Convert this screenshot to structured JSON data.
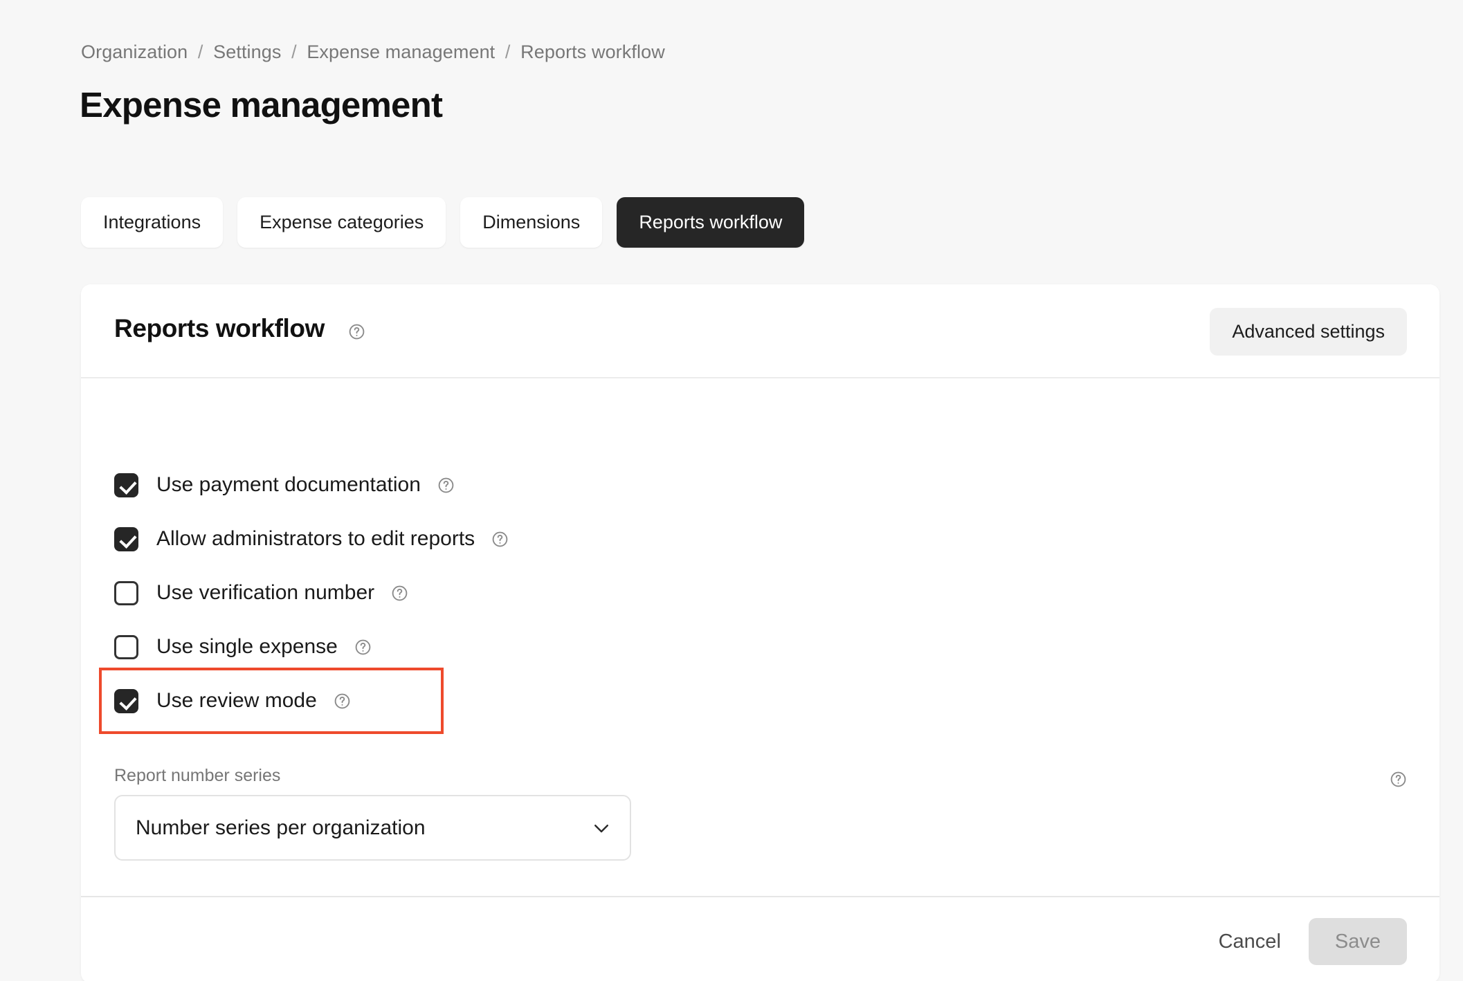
{
  "breadcrumb": {
    "items": [
      "Organization",
      "Settings",
      "Expense management",
      "Reports workflow"
    ],
    "separator": "/"
  },
  "page": {
    "title": "Expense management"
  },
  "tabs": [
    {
      "label": "Integrations",
      "active": false
    },
    {
      "label": "Expense categories",
      "active": false
    },
    {
      "label": "Dimensions",
      "active": false
    },
    {
      "label": "Reports workflow",
      "active": true
    }
  ],
  "card": {
    "title": "Reports workflow",
    "title_help_icon": "help-circle-icon",
    "advanced_settings_label": "Advanced settings"
  },
  "checkboxes": [
    {
      "label": "Use payment documentation",
      "checked": true,
      "help_icon": "help-circle-icon",
      "highlighted": false
    },
    {
      "label": "Allow administrators to edit reports",
      "checked": true,
      "help_icon": "help-circle-icon",
      "highlighted": false
    },
    {
      "label": "Use verification number",
      "checked": false,
      "help_icon": "help-circle-icon",
      "highlighted": false
    },
    {
      "label": "Use single expense",
      "checked": false,
      "help_icon": "help-circle-icon",
      "highlighted": false
    },
    {
      "label": "Use review mode",
      "checked": true,
      "help_icon": "help-circle-icon",
      "highlighted": true
    }
  ],
  "report_number_series": {
    "label": "Report number series",
    "selected": "Number series per organization",
    "chevron_icon": "chevron-down-icon",
    "help_icon": "help-circle-icon"
  },
  "footer": {
    "cancel_label": "Cancel",
    "save_label": "Save",
    "save_disabled": true
  },
  "colors": {
    "background": "#f7f7f7",
    "card": "#ffffff",
    "accent_dark": "#262626",
    "highlight_red": "#ee4a2c",
    "muted_text": "#777777",
    "disabled_button": "#dedede"
  }
}
